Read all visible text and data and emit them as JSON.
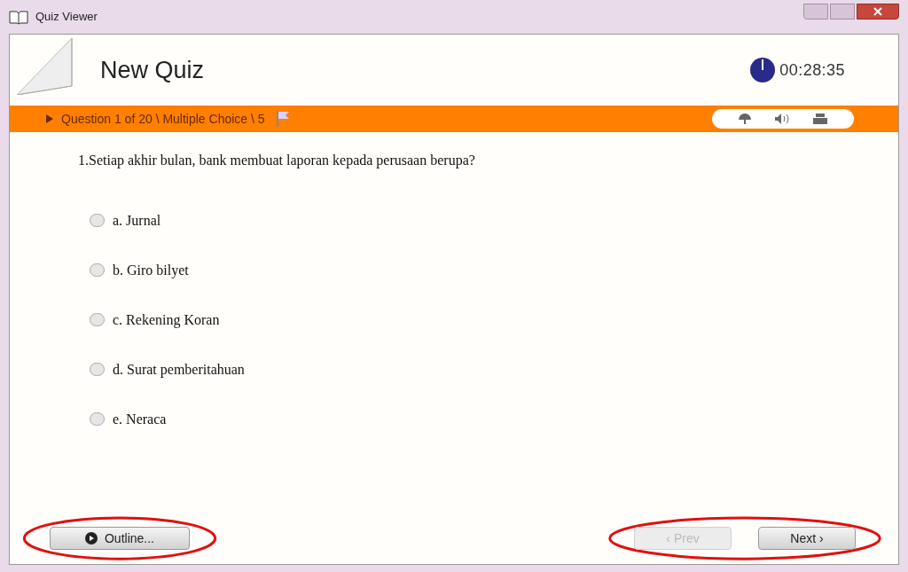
{
  "window": {
    "title": "Quiz Viewer"
  },
  "header": {
    "title": "New Quiz",
    "timer": "00:28:35"
  },
  "question_bar": {
    "label": "Question 1 of 20 \\ Multiple Choice \\ 5"
  },
  "question": {
    "text": "1.Setiap akhir bulan, bank membuat laporan kepada perusaan berupa?",
    "options": [
      {
        "label": "a. Jurnal",
        "selected": false
      },
      {
        "label": "b. Giro bilyet",
        "selected": false
      },
      {
        "label": "c. Rekening Koran",
        "selected": false
      },
      {
        "label": "d. Surat pemberitahuan",
        "selected": false
      },
      {
        "label": "e. Neraca",
        "selected": false
      }
    ]
  },
  "footer": {
    "outline": {
      "label": "Outline...",
      "highlighted": true
    },
    "nav": {
      "highlighted": true,
      "prev": {
        "label": "‹ Prev",
        "disabled": true
      },
      "next": {
        "label": "Next ›",
        "disabled": false
      }
    }
  }
}
